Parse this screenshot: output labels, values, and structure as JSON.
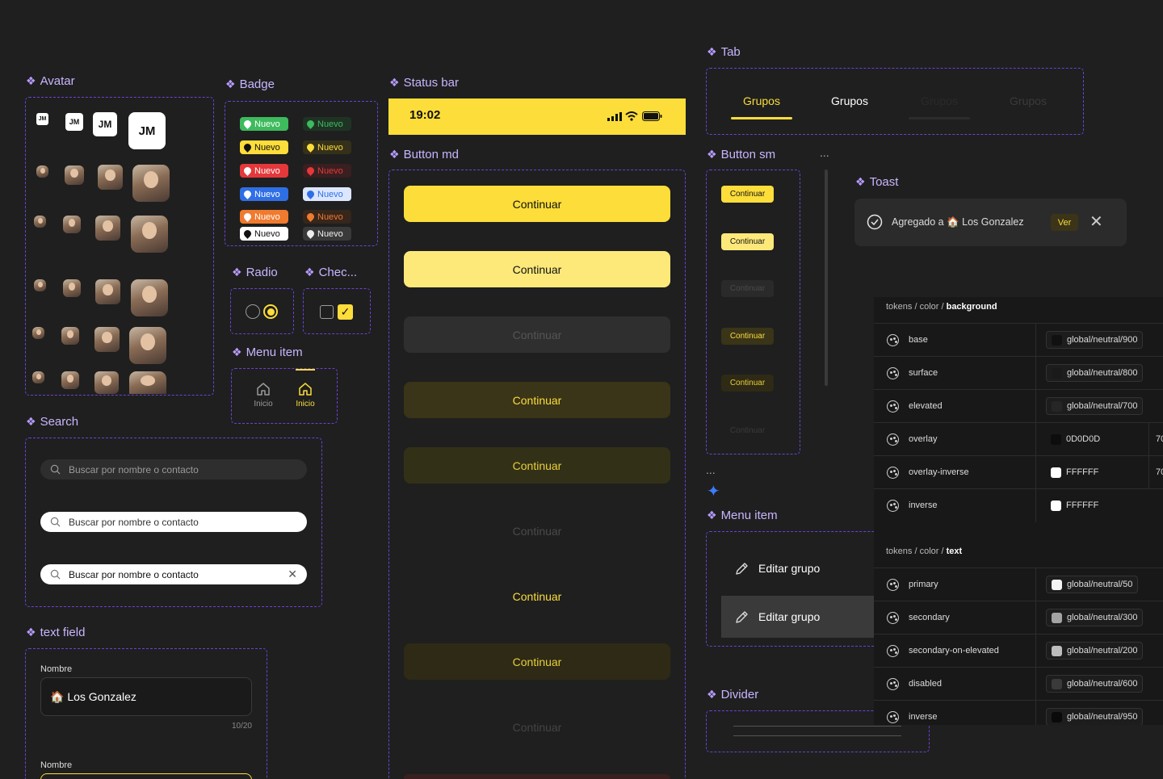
{
  "sections": {
    "avatar": "Avatar",
    "badge": "Badge",
    "status_bar": "Status bar",
    "tab": "Tab",
    "button_md": "Button md",
    "button_sm": "Button sm",
    "toast": "Toast",
    "radio": "Radio",
    "checkbox": "Chec...",
    "menu_item_small": "Menu item",
    "search": "Search",
    "text_field": "text field",
    "menu_item": "Menu item",
    "divider": "Divider",
    "ellipsis": "..."
  },
  "avatar": {
    "initials": "JM"
  },
  "badge": {
    "label": "Nuevo"
  },
  "status_bar": {
    "time": "19:02"
  },
  "tabs": [
    "Grupos",
    "Grupos",
    "Grupos",
    "Grupos"
  ],
  "button_md_label": "Continuar",
  "button_sm_label": "Continuar",
  "toast": {
    "message": "Agregado a 🏠 Los Gonzalez",
    "action": "Ver"
  },
  "menu_nav": {
    "label_1": "Inicio",
    "label_2": "Inicio"
  },
  "search": {
    "placeholder": "Buscar por nombre o contacto"
  },
  "text_field": {
    "label": "Nombre",
    "value": "🏠 Los Gonzalez",
    "counter": "10/20",
    "label_2": "Nombre"
  },
  "menu_item": {
    "label": "Editar grupo"
  },
  "tokens": {
    "background_head": {
      "prefix": "tokens / color / ",
      "name": "background"
    },
    "background": [
      {
        "name": "base",
        "value": "global/neutral/900",
        "swatch": "#111111"
      },
      {
        "name": "surface",
        "value": "global/neutral/800",
        "swatch": "#1a1a1a"
      },
      {
        "name": "elevated",
        "value": "global/neutral/700",
        "swatch": "#262626"
      },
      {
        "name": "overlay",
        "value": "0D0D0D",
        "swatch": "#0d0d0d",
        "extra": "70"
      },
      {
        "name": "overlay-inverse",
        "value": "FFFFFF",
        "swatch": "#ffffff",
        "extra": "70"
      },
      {
        "name": "inverse",
        "value": "FFFFFF",
        "swatch": "#ffffff"
      }
    ],
    "text_head": {
      "prefix": "tokens / color / ",
      "name": "text"
    },
    "text": [
      {
        "name": "primary",
        "value": "global/neutral/50",
        "swatch": "#f5f5f5"
      },
      {
        "name": "secondary",
        "value": "global/neutral/300",
        "swatch": "#a3a3a3"
      },
      {
        "name": "secondary-on-elevated",
        "value": "global/neutral/200",
        "swatch": "#bdbdbd"
      },
      {
        "name": "disabled",
        "value": "global/neutral/600",
        "swatch": "#3a3a3a"
      },
      {
        "name": "inverse",
        "value": "global/neutral/950",
        "swatch": "#0a0a0a"
      }
    ]
  },
  "colors": {
    "accent": "#fcdd3a",
    "dashed_border": "#6a42d6",
    "title": "#c9b5ff",
    "background": "#1f1f1f"
  }
}
